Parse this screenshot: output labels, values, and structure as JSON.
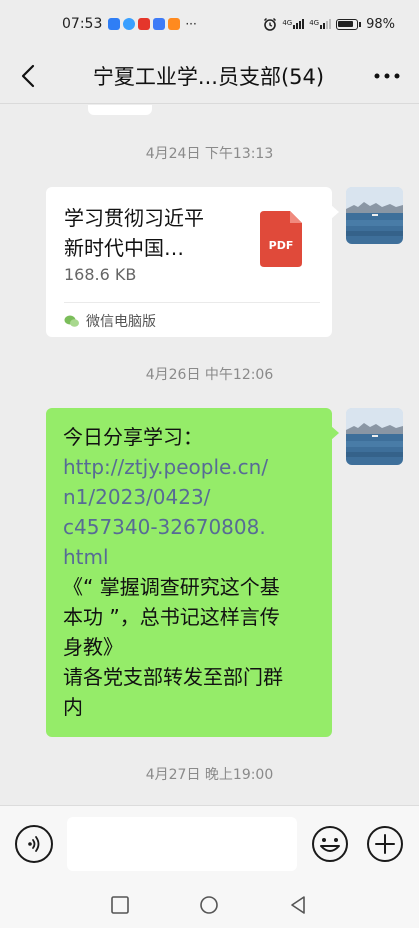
{
  "status_bar": {
    "time": "07:53",
    "notification_icons": [
      "search-app-icon",
      "browser-app-icon",
      "news-app-icon",
      "map-app-icon",
      "video-app-icon"
    ],
    "more_notifications": "···",
    "network_1": "4G",
    "network_2": "4G",
    "battery": "98%"
  },
  "header": {
    "title": "宁夏工业学...员支部(54)",
    "back_icon": "chevron-left-icon",
    "more_icon": "more-dots-icon"
  },
  "messages": [
    {
      "type": "timestamp",
      "text": "4月24日 下午13:13"
    },
    {
      "type": "file",
      "sender": "self",
      "title_line_1": "学习贯彻习近平",
      "title_line_2": "新时代中国…",
      "size": "168.6 KB",
      "badge": "PDF",
      "source": "微信电脑版"
    },
    {
      "type": "timestamp",
      "text": "4月26日 中午12:06"
    },
    {
      "type": "text",
      "sender": "self",
      "lines": {
        "l1": "今日分享学习：",
        "url1": "http://ztjy.people.cn/",
        "url2": "n1/2023/0423/",
        "url3": "c457340-32670808.",
        "url4": "html",
        "l2": "《“ 掌握调查研究这个基",
        "l3": "本功 ”，总书记这样言传",
        "l4": "身教》",
        "l5": "请各党支部转发至部门群",
        "l6": "内"
      }
    },
    {
      "type": "timestamp",
      "text": "4月27日 晚上19:00"
    }
  ],
  "input_bar": {
    "value": "",
    "voice_icon": "voice-icon",
    "emoji_icon": "emoji-icon",
    "plus_icon": "plus-icon"
  },
  "nav": {
    "recents": "square-icon",
    "home": "circle-icon",
    "back": "triangle-back-icon"
  },
  "colors": {
    "background": "#ededed",
    "bubble_green": "#95ec69",
    "link": "#576b95",
    "pdf_red": "#e04a3a"
  }
}
